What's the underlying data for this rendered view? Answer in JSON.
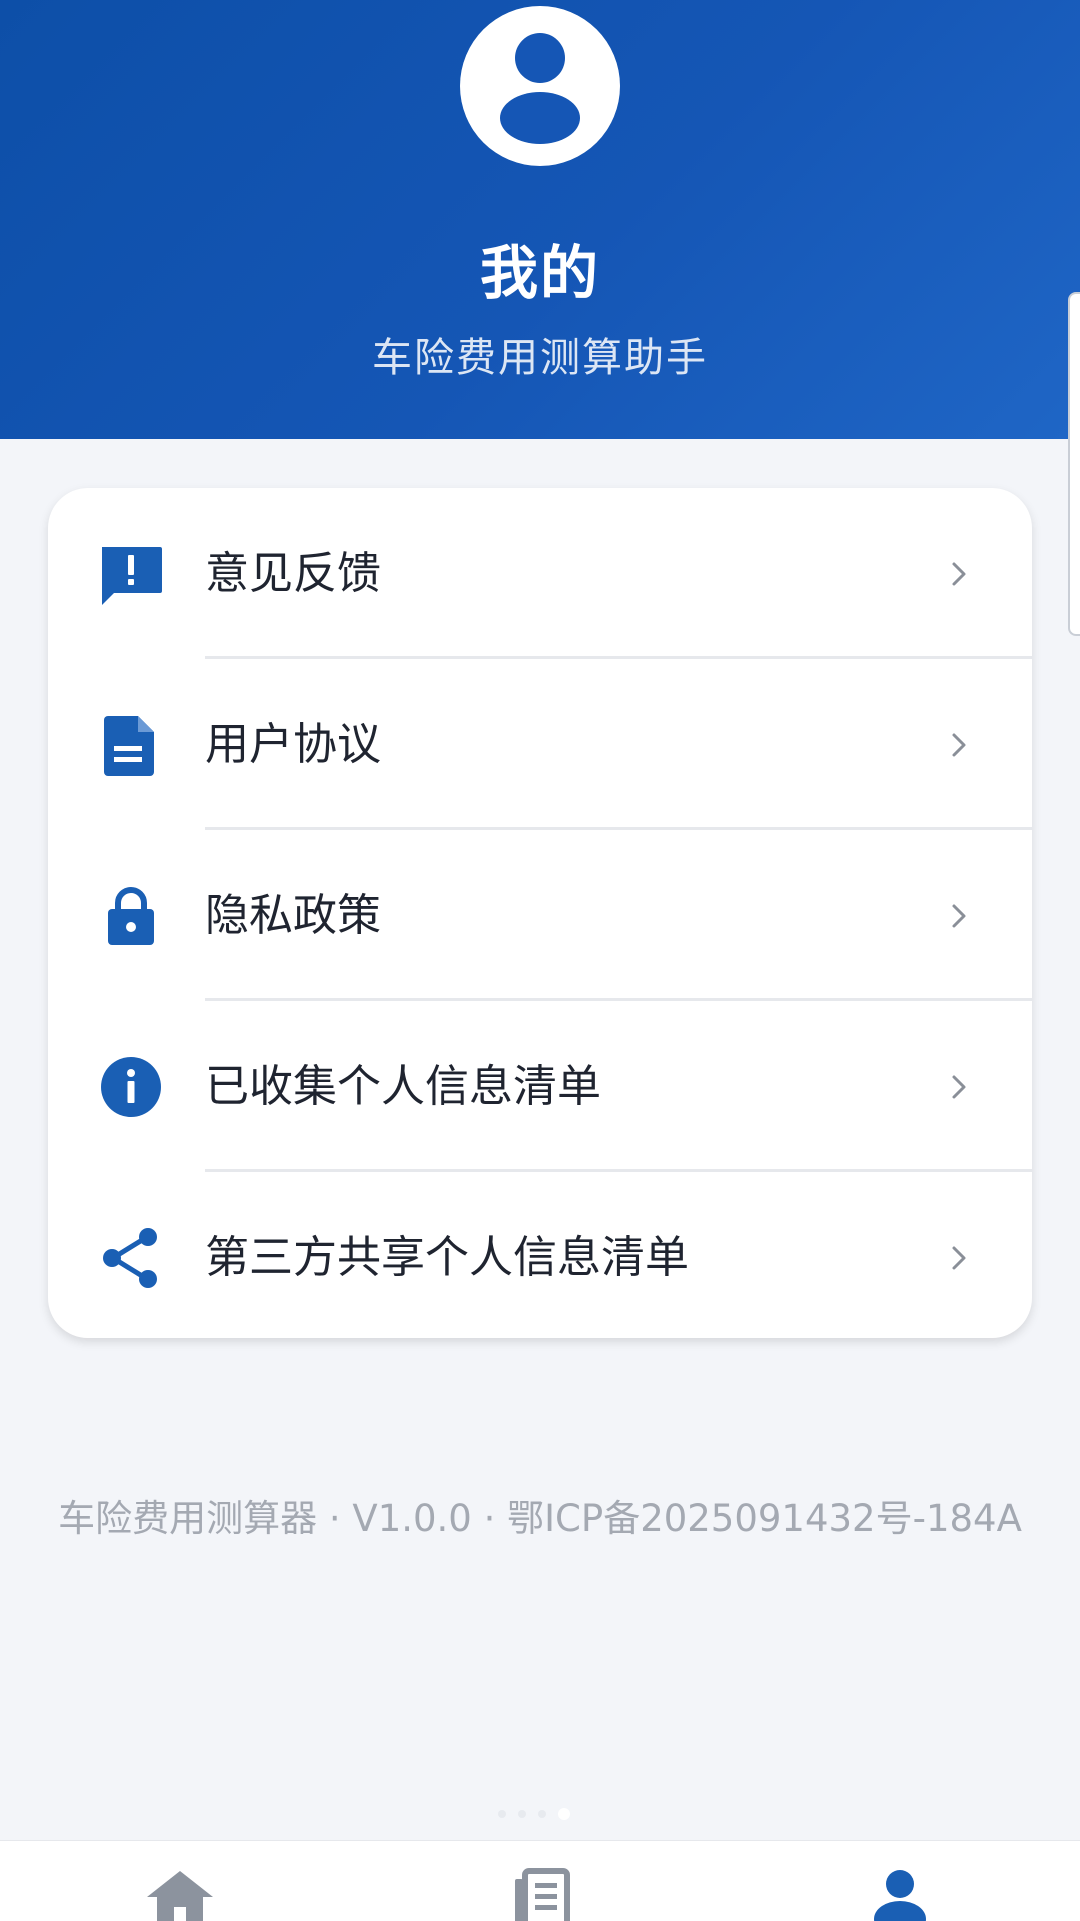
{
  "header": {
    "title": "我的",
    "subtitle": "车险费用测算助手"
  },
  "menu": {
    "items": [
      {
        "label": "意见反馈",
        "icon": "feedback-icon"
      },
      {
        "label": "用户协议",
        "icon": "document-icon"
      },
      {
        "label": "隐私政策",
        "icon": "lock-icon"
      },
      {
        "label": "已收集个人信息清单",
        "icon": "info-icon"
      },
      {
        "label": "第三方共享个人信息清单",
        "icon": "share-icon"
      }
    ]
  },
  "footer": {
    "text": "车险费用测算器 · V1.0.0 · 鄂ICP备2025091432号-184A"
  },
  "bottom_nav": {
    "items": [
      {
        "icon": "home-icon",
        "active": false
      },
      {
        "icon": "news-icon",
        "active": false
      },
      {
        "icon": "profile-icon",
        "active": true
      }
    ]
  },
  "colors": {
    "brand": "#1556b5",
    "icon": "#1a5fb4",
    "text": "#1f2430",
    "muted": "#a4a9b2",
    "background": "#f3f5f9"
  }
}
